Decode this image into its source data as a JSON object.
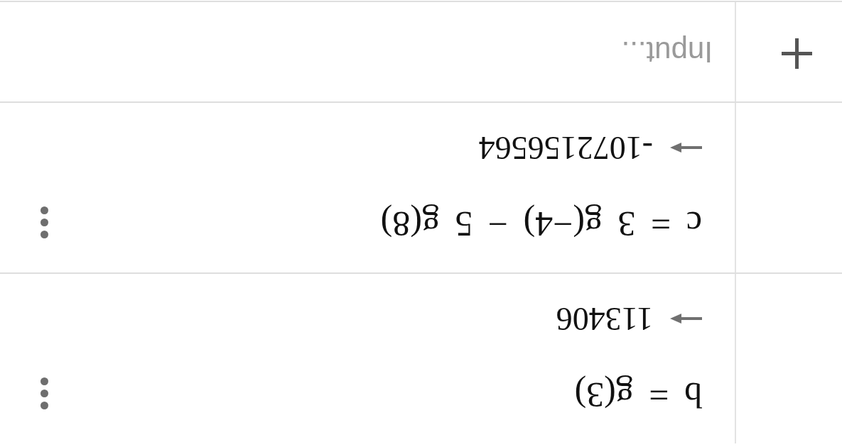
{
  "upside_down": true,
  "items": [
    {
      "definition": "b = g(3)",
      "output": "113406"
    },
    {
      "definition": "c = 3 g(−4) − 5 g(8)",
      "output": "-1072156564"
    }
  ],
  "input_bar": {
    "placeholder": "Input..."
  }
}
